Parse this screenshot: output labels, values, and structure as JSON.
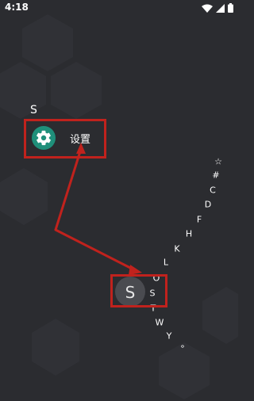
{
  "status_bar": {
    "time": "4:18",
    "icons": [
      "wifi-icon",
      "signal-icon",
      "battery-icon"
    ]
  },
  "app_list": {
    "group_letter": "S",
    "items": [
      {
        "label": "设置",
        "icon": "gear-icon",
        "icon_color": "#1f8f7a"
      }
    ]
  },
  "alphabet_index": {
    "letters": [
      "☆",
      "#",
      "C",
      "D",
      "F",
      "H",
      "K",
      "L",
      "O",
      "S",
      "T",
      "W",
      "Y",
      "°"
    ],
    "selected": "S"
  },
  "annotations": {
    "highlight_color": "#c0221d",
    "arrow_color": "#c0221d"
  }
}
